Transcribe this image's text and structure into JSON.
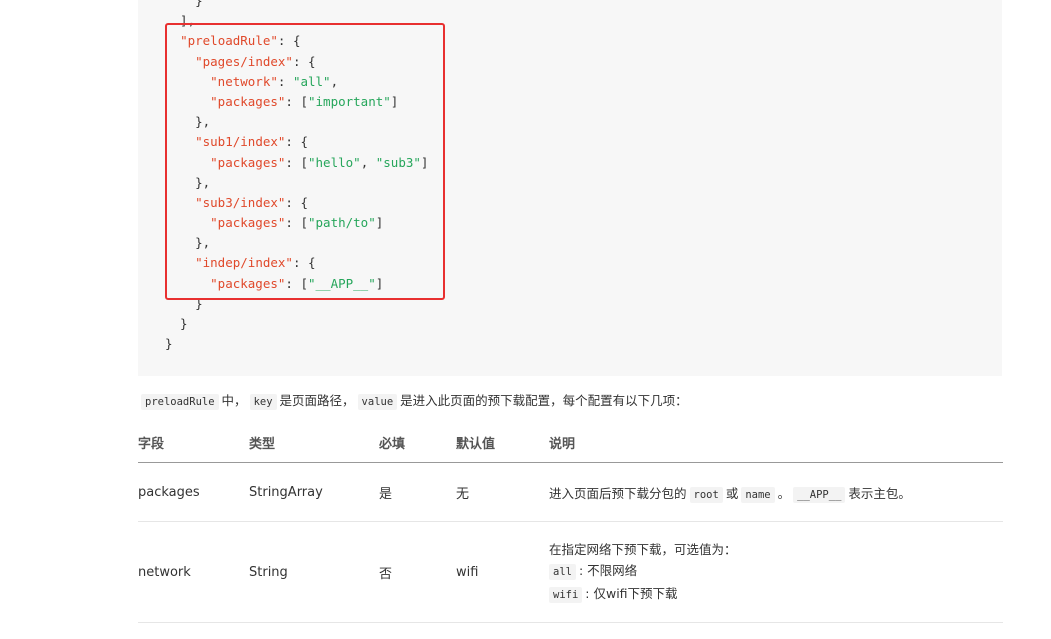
{
  "code": {
    "lines": [
      [
        {
          "t": "    }",
          "c": "p"
        }
      ],
      [
        {
          "t": "  ],",
          "c": "p"
        }
      ],
      [
        {
          "t": "  ",
          "c": "p"
        },
        {
          "t": "\"preloadRule\"",
          "c": "k"
        },
        {
          "t": ": {",
          "c": "p"
        }
      ],
      [
        {
          "t": "    ",
          "c": "p"
        },
        {
          "t": "\"pages/index\"",
          "c": "k"
        },
        {
          "t": ": {",
          "c": "p"
        }
      ],
      [
        {
          "t": "      ",
          "c": "p"
        },
        {
          "t": "\"network\"",
          "c": "k"
        },
        {
          "t": ": ",
          "c": "p"
        },
        {
          "t": "\"all\"",
          "c": "s"
        },
        {
          "t": ",",
          "c": "p"
        }
      ],
      [
        {
          "t": "      ",
          "c": "p"
        },
        {
          "t": "\"packages\"",
          "c": "k"
        },
        {
          "t": ": [",
          "c": "p"
        },
        {
          "t": "\"important\"",
          "c": "s"
        },
        {
          "t": "]",
          "c": "p"
        }
      ],
      [
        {
          "t": "    },",
          "c": "p"
        }
      ],
      [
        {
          "t": "    ",
          "c": "p"
        },
        {
          "t": "\"sub1/index\"",
          "c": "k"
        },
        {
          "t": ": {",
          "c": "p"
        }
      ],
      [
        {
          "t": "      ",
          "c": "p"
        },
        {
          "t": "\"packages\"",
          "c": "k"
        },
        {
          "t": ": [",
          "c": "p"
        },
        {
          "t": "\"hello\"",
          "c": "s"
        },
        {
          "t": ", ",
          "c": "p"
        },
        {
          "t": "\"sub3\"",
          "c": "s"
        },
        {
          "t": "]",
          "c": "p"
        }
      ],
      [
        {
          "t": "    },",
          "c": "p"
        }
      ],
      [
        {
          "t": "    ",
          "c": "p"
        },
        {
          "t": "\"sub3/index\"",
          "c": "k"
        },
        {
          "t": ": {",
          "c": "p"
        }
      ],
      [
        {
          "t": "      ",
          "c": "p"
        },
        {
          "t": "\"packages\"",
          "c": "k"
        },
        {
          "t": ": [",
          "c": "p"
        },
        {
          "t": "\"path/to\"",
          "c": "s"
        },
        {
          "t": "]",
          "c": "p"
        }
      ],
      [
        {
          "t": "    },",
          "c": "p"
        }
      ],
      [
        {
          "t": "    ",
          "c": "p"
        },
        {
          "t": "\"indep/index\"",
          "c": "k"
        },
        {
          "t": ": {",
          "c": "p"
        }
      ],
      [
        {
          "t": "      ",
          "c": "p"
        },
        {
          "t": "\"packages\"",
          "c": "k"
        },
        {
          "t": ": [",
          "c": "p"
        },
        {
          "t": "\"__APP__\"",
          "c": "s"
        },
        {
          "t": "]",
          "c": "p"
        }
      ],
      [
        {
          "t": "    }",
          "c": "p"
        }
      ],
      [
        {
          "t": "  }",
          "c": "p"
        }
      ],
      [
        {
          "t": "}",
          "c": "p"
        }
      ]
    ]
  },
  "description": {
    "code1": "preloadRule",
    "text1": "中，",
    "code2": "key",
    "text2": "是页面路径，",
    "code3": "value",
    "text3": "是进入此页面的预下载配置，每个配置有以下几项："
  },
  "table": {
    "headers": [
      "字段",
      "类型",
      "必填",
      "默认值",
      "说明"
    ],
    "row1": {
      "field": "packages",
      "type": "StringArray",
      "required": "是",
      "default": "无",
      "note_text1": "进入页面后预下载分包的",
      "note_code1": "root",
      "note_text2": "或",
      "note_code2": "name",
      "note_text3": "。",
      "note_code3": "__APP__",
      "note_text4": "表示主包。"
    },
    "row2": {
      "field": "network",
      "type": "String",
      "required": "否",
      "default": "wifi",
      "note_line1": "在指定网络下预下载，可选值为：",
      "note_code_a": "all",
      "note_text_a": ": 不限网络",
      "note_code_b": "wifi",
      "note_text_b": ": 仅wifi下预下载"
    }
  },
  "colors": {
    "key": "#e0492b",
    "string": "#26a65b",
    "highlight_box": "#e83030",
    "code_background": "#f7f7f7"
  }
}
